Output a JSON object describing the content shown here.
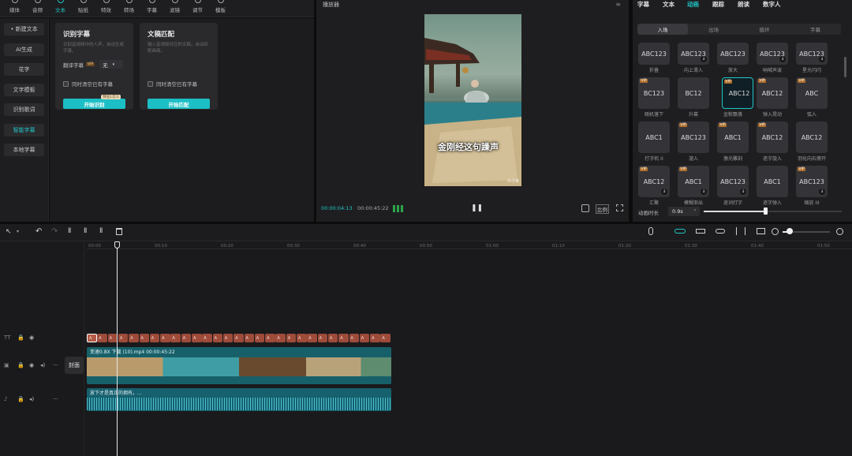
{
  "toolbar": {
    "tabs": [
      {
        "label": "媒体",
        "icon": "media-icon"
      },
      {
        "label": "音频",
        "icon": "audio-icon"
      },
      {
        "label": "文本",
        "icon": "text-icon",
        "active": true
      },
      {
        "label": "贴纸",
        "icon": "sticker-icon"
      },
      {
        "label": "特效",
        "icon": "effects-icon"
      },
      {
        "label": "转场",
        "icon": "transition-icon"
      },
      {
        "label": "字幕",
        "icon": "caption-icon"
      },
      {
        "label": "滤镜",
        "icon": "filter-icon"
      },
      {
        "label": "调节",
        "icon": "adjust-icon"
      },
      {
        "label": "模板",
        "icon": "template-icon"
      }
    ]
  },
  "sidenav": {
    "items": [
      "• 新建文本",
      "AI生成",
      "花字",
      "文字模板",
      "识别歌词",
      "智能字幕",
      "本地字幕"
    ],
    "active_index": 5
  },
  "cards": {
    "recognize": {
      "title": "识别字幕",
      "desc": "识别音视频中的人声，自动生成字幕。",
      "translate_label": "翻译字幕",
      "translate_value": "无",
      "clear_label": "同时清空已有字幕",
      "button": "开始识别",
      "tooltip": "预估1次/1"
    },
    "match": {
      "title": "文稿匹配",
      "desc": "输入音视频对应的文稿，自动匹配画面。",
      "clear_label": "同时清空已有字幕",
      "button": "开始匹配"
    }
  },
  "player": {
    "title": "播放器",
    "caption": "金刚经这句躁声",
    "watermark": "©小米",
    "time_current": "00:00:04:13",
    "time_total": "00:00:45:22",
    "ratio_label": "比例"
  },
  "rpanel": {
    "tabs": [
      "字幕",
      "文本",
      "动画",
      "跟踪",
      "朗读",
      "数字人"
    ],
    "active_tab": 2,
    "subtabs": [
      "入场",
      "出场",
      "循环",
      "字幕"
    ],
    "active_subtab": 0,
    "tiles": [
      {
        "text": "ABC123",
        "label": "折叠",
        "vip": false,
        "dl": false
      },
      {
        "text": "ABC123",
        "label": "向上滑入",
        "vip": false,
        "dl": true
      },
      {
        "text": "ABC123",
        "label": "放大",
        "vip": false,
        "dl": false
      },
      {
        "text": "ABC123",
        "label": "呐喊声波",
        "vip": false,
        "dl": true
      },
      {
        "text": "ABC123",
        "label": "星光闪闪",
        "vip": false,
        "dl": true
      },
      {
        "text": "BC123",
        "label": "随机落下",
        "vip": true,
        "dl": false
      },
      {
        "text": "BC12",
        "label": "升幕",
        "vip": false,
        "dl": false
      },
      {
        "text": "ABC12",
        "label": "金粉飘落",
        "vip": true,
        "dl": false,
        "selected": true
      },
      {
        "text": "ABC12",
        "label": "弹入晃动",
        "vip": true,
        "dl": false
      },
      {
        "text": "ABC",
        "label": "弧入",
        "vip": true,
        "dl": false
      },
      {
        "text": "ABC1",
        "label": "打字机 II",
        "vip": false,
        "dl": false
      },
      {
        "text": "ABC123",
        "label": "溜入",
        "vip": true,
        "dl": false
      },
      {
        "text": "ABC1",
        "label": "激光雕刻",
        "vip": true,
        "dl": false
      },
      {
        "text": "ABC12",
        "label": "逐字旋入",
        "vip": true,
        "dl": false
      },
      {
        "text": "ABC12",
        "label": "羽化向右擦开",
        "vip": false,
        "dl": false
      },
      {
        "text": "ABC12",
        "label": "汇聚",
        "vip": true,
        "dl": true
      },
      {
        "text": "ABC1",
        "label": "模糊渐出",
        "vip": true,
        "dl": true
      },
      {
        "text": "ABC123",
        "label": "逐词打字",
        "vip": false,
        "dl": true
      },
      {
        "text": "ABC1",
        "label": "逐字弹入",
        "vip": false,
        "dl": false
      },
      {
        "text": "ABC123",
        "label": "缩放 III",
        "vip": true,
        "dl": true
      }
    ],
    "duration_label": "动画时长",
    "duration_value": "0.9s"
  },
  "timeline": {
    "ticks": [
      "00:00",
      "00:10",
      "00:20",
      "00:30",
      "00:40",
      "00:50",
      "01:00",
      "01:10",
      "01:20",
      "01:30",
      "01:40",
      "01:50"
    ],
    "cover_label": "封面",
    "video_clip_label": "变速0.8X  下载 (10).mp4  00:00:45:22",
    "audio_clip_label": "放下才是真正的拥有。…"
  },
  "colors": {
    "accent": "#20c6c6",
    "text_clip": "#9e4b3a",
    "video_clip": "#16656d",
    "audio_clip": "#17606e"
  }
}
